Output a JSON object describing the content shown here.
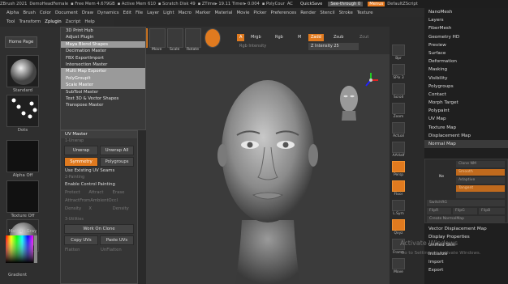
{
  "titlebar": {
    "items": [
      "ZBrush 2021",
      "DemoHeadFemale",
      "▪ Free Mem 4.679GB",
      "▪ Active Mem 610",
      "▪ Scratch Disk 49",
      "▪ ZTime▸ 19.11 Timer▸ 0.004",
      "▪ PolyCour",
      "AC"
    ],
    "quicksave": "QuickSave",
    "seethrough": "See-through 0",
    "menus": "Menus",
    "script": "DefaultZScript"
  },
  "menubar": [
    "Alpha",
    "Brush",
    "Color",
    "Document",
    "Draw",
    "Dynamics",
    "Edit",
    "File",
    "Layer",
    "Light",
    "Macro",
    "Marker",
    "Material",
    "Movie",
    "Picker",
    "Preferences",
    "Render",
    "Stencil",
    "Stroke",
    "Texture"
  ],
  "toolbar": [
    "Tool",
    "Transform",
    "Zplugin",
    "Zscript",
    "Help"
  ],
  "lefttray": {
    "home_page": "Home Page",
    "standard": "Standard",
    "dots": "Dots",
    "alpha_off": "Alpha Off",
    "texture_off": "Texture Off",
    "matcap": "MatCap Gray",
    "gradient": "Gradient"
  },
  "plugin_menu": [
    {
      "label": "3D Print Hub",
      "hl": false
    },
    {
      "label": "Adjust Plugin",
      "hl": false
    },
    {
      "label": "Maya Blend Shapes",
      "hl": true
    },
    {
      "label": "Decimation Master",
      "hl": false
    },
    {
      "label": "FBX ExportImport",
      "hl": false
    },
    {
      "label": "Intersection Master",
      "hl": false
    },
    {
      "label": "Multi Map Exporter",
      "hl": true
    },
    {
      "label": "PolyGroupIt",
      "hl": true
    },
    {
      "label": "Scale Master",
      "hl": true
    },
    {
      "label": "SubTool Master",
      "hl": false
    },
    {
      "label": "Text 3D & Vector Shapes",
      "hl": false
    },
    {
      "label": "Transpose Master",
      "hl": false
    }
  ],
  "uv_panel": {
    "header": "UV Master",
    "unwrap_sub": "1-Unwrap",
    "unwrap": "Unwrap",
    "unwrap_all": "Unwrap All",
    "symmetry": "Symmetry",
    "polygroups": "Polygroups",
    "use_existing": "Use Existing UV Seams",
    "painting_sub": "2-Painting",
    "enable_cp": "Enable Control Painting",
    "protect": "Protect",
    "attract": "Attract",
    "erase": "Erase",
    "attract_ao": "AttractFromAmbientOccl",
    "density": "Density",
    "x": "X",
    "density_sub": "Density",
    "flat_sub": "3-Utilities",
    "work_on_clone": "Work On Clone",
    "copy_uvs": "Copy UVs",
    "paste_uvs": "Paste UVs",
    "flatten": "Flatten",
    "unflatten": "UnFlatten"
  },
  "shelf": {
    "edit": "Edit",
    "draw": "Draw",
    "move": "Move",
    "scale": "Scale",
    "rotate": "Rotate",
    "a": "A",
    "mrgb": "Mrgb",
    "rgb": "Rgb",
    "m": "M",
    "zadd": "Zadd",
    "zsub": "Zsub",
    "zcut": "Zcut",
    "rgb_intensity": "Rgb Intensity",
    "z_intensity": "Z Intensity 25"
  },
  "right_shelf": [
    "Bpr",
    "SPix 3",
    "Scroll",
    "Zoom",
    "Actual",
    "AAHalf",
    "Persp",
    "Floor",
    "L.Sym",
    "Qxyz",
    "Frame",
    "Move"
  ],
  "right_menu": [
    {
      "label": "NanoMesh",
      "hl": false
    },
    {
      "label": "Layers",
      "hl": false
    },
    {
      "label": "FiberMesh",
      "hl": false
    },
    {
      "label": "Geometry HD",
      "hl": false
    },
    {
      "label": "Preview",
      "hl": false
    },
    {
      "label": "Surface",
      "hl": false
    },
    {
      "label": "Deformation",
      "hl": false
    },
    {
      "label": "Masking",
      "hl": false
    },
    {
      "label": "Visibility",
      "hl": false
    },
    {
      "label": "Polygroups",
      "hl": false
    },
    {
      "label": "Contact",
      "hl": false
    },
    {
      "label": "Morph Target",
      "hl": false
    },
    {
      "label": "Polypaint",
      "hl": false
    },
    {
      "label": "UV Map",
      "hl": false
    },
    {
      "label": "Texture Map",
      "hl": false
    },
    {
      "label": "Displacement Map",
      "hl": false
    },
    {
      "label": "Normal Map",
      "hl": true
    }
  ],
  "right_menu_bottom": [
    "Vector Displacement Map",
    "Display Properties",
    "Unified Skin",
    "Initialize",
    "Import",
    "Export"
  ],
  "nm_panel": {
    "clone_nm": "Clone NM",
    "ne": "Ne",
    "smooth": "Smooth",
    "adaptive": "Adaptive",
    "tangent": "Tangent",
    "switch_rg": "SwitchRG",
    "flip_r": "FlipR",
    "flip_g": "FlipG",
    "flip_b": "FlipB",
    "create": "Create NormalMap"
  },
  "watermark": {
    "title": "Activate Windows",
    "sub": "Go to Settings to activate Windows."
  },
  "colors": {
    "accent": "#e07a1f",
    "bg": "#2a2a2a",
    "viewport": "#3b3b3b"
  }
}
